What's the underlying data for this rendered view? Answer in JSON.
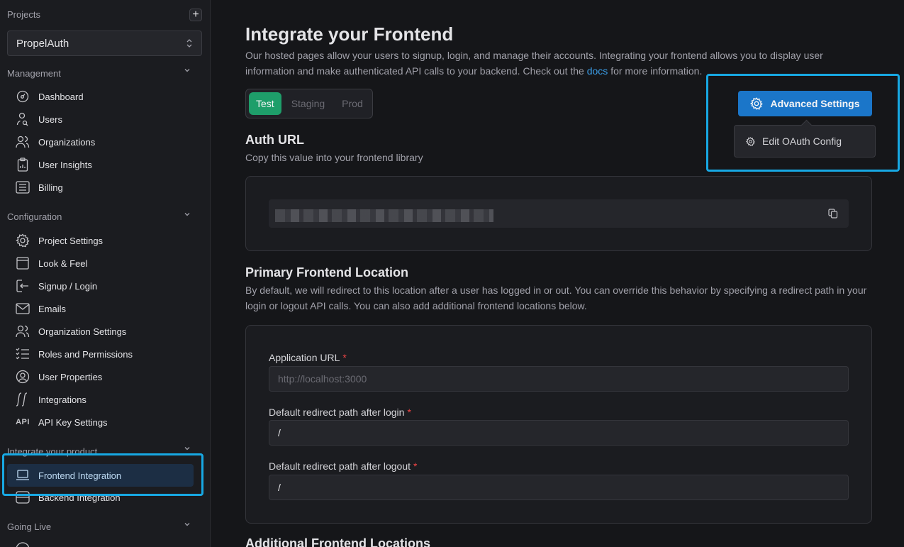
{
  "sidebar": {
    "projects_label": "Projects",
    "add_project_icon": "plus-icon",
    "project_select": {
      "value": "PropelAuth",
      "icon": "updown-icon"
    },
    "sections": [
      {
        "title": "Management",
        "items": [
          {
            "label": "Dashboard",
            "icon": "gauge-icon"
          },
          {
            "label": "Users",
            "icon": "user-search-icon"
          },
          {
            "label": "Organizations",
            "icon": "users-icon"
          },
          {
            "label": "User Insights",
            "icon": "clipboard-chart-icon"
          },
          {
            "label": "Billing",
            "icon": "list-box-icon"
          }
        ]
      },
      {
        "title": "Configuration",
        "items": [
          {
            "label": "Project Settings",
            "icon": "gear-icon"
          },
          {
            "label": "Look & Feel",
            "icon": "window-icon"
          },
          {
            "label": "Signup / Login",
            "icon": "login-icon"
          },
          {
            "label": "Emails",
            "icon": "mail-icon"
          },
          {
            "label": "Organization Settings",
            "icon": "users-icon"
          },
          {
            "label": "Roles and Permissions",
            "icon": "checklist-icon"
          },
          {
            "label": "User Properties",
            "icon": "user-circle-icon"
          },
          {
            "label": "Integrations",
            "icon": "integral-icon"
          },
          {
            "label": "API Key Settings",
            "icon": "api-icon",
            "glyph": "API"
          }
        ]
      },
      {
        "title": "Integrate your product",
        "items": [
          {
            "label": "Frontend Integration",
            "icon": "laptop-icon",
            "active": true
          },
          {
            "label": "Backend Integration",
            "icon": "server-icon"
          }
        ]
      },
      {
        "title": "Going Live",
        "items": []
      }
    ]
  },
  "main": {
    "title": "Integrate your Frontend",
    "description_before_link": "Our hosted pages allow your users to signup, login, and manage their accounts. Integrating your frontend allows you to display user information and make authenticated API calls to your backend. Check out the ",
    "docs_link": "docs",
    "description_after_link": " for more information.",
    "env_tabs": [
      {
        "label": "Test",
        "active": true
      },
      {
        "label": "Staging",
        "active": false
      },
      {
        "label": "Prod",
        "active": false
      }
    ],
    "advanced_settings": {
      "button_label": "Advanced Settings",
      "menu_items": [
        {
          "label": "Edit OAuth Config",
          "icon": "gear-icon"
        }
      ]
    },
    "auth_url": {
      "heading": "Auth URL",
      "subtext": "Copy this value into your frontend library",
      "value_redacted": true,
      "copy_icon": "copy-icon"
    },
    "primary_location": {
      "heading": "Primary Frontend Location",
      "subtext": "By default, we will redirect to this location after a user has logged in or out. You can override this behavior by specifying a redirect path in your login or logout API calls. You can also add additional frontend locations below.",
      "fields": [
        {
          "label": "Application URL",
          "required": "*",
          "value": "",
          "placeholder": "http://localhost:3000"
        },
        {
          "label": "Default redirect path after login",
          "required": "*",
          "value": "/",
          "placeholder": ""
        },
        {
          "label": "Default redirect path after logout",
          "required": "*",
          "value": "/",
          "placeholder": ""
        }
      ]
    },
    "additional_locations": {
      "heading": "Additional Frontend Locations"
    }
  }
}
